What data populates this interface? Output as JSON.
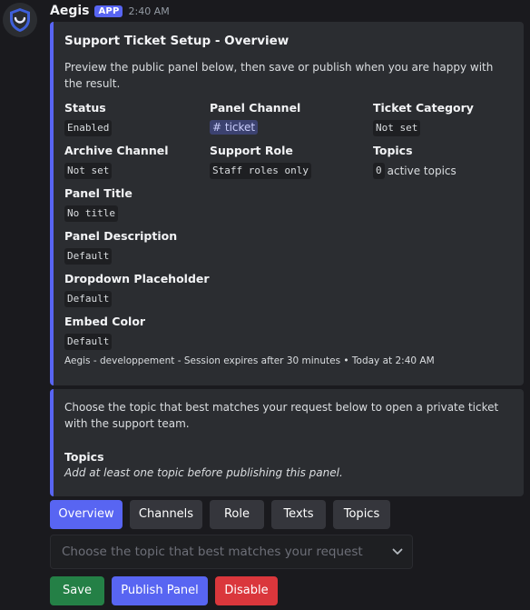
{
  "message": {
    "author": "Aegis",
    "app_tag": "APP",
    "time": "2:40 AM"
  },
  "overview": {
    "title": "Support Ticket Setup - Overview",
    "description": "Preview the public panel below, then save or publish when you are happy with the result.",
    "fields": {
      "status": {
        "name": "Status",
        "value": "Enabled"
      },
      "panel_channel": {
        "name": "Panel Channel",
        "value": "ticket"
      },
      "ticket_category": {
        "name": "Ticket Category",
        "value": "Not set"
      },
      "archive_channel": {
        "name": "Archive Channel",
        "value": "Not set"
      },
      "support_role": {
        "name": "Support Role",
        "value": "Staff roles only"
      },
      "topics": {
        "name": "Topics",
        "count": "0",
        "suffix": "active topics"
      },
      "panel_title": {
        "name": "Panel Title",
        "value": "No title"
      },
      "panel_description": {
        "name": "Panel Description",
        "value": "Default"
      },
      "dropdown_placeholder": {
        "name": "Dropdown Placeholder",
        "value": "Default"
      },
      "embed_color": {
        "name": "Embed Color",
        "value": "Default"
      }
    },
    "footer": "Aegis - developpement - Session expires after 30 minutes • Today at 2:40 AM"
  },
  "preview": {
    "description": "Choose the topic that best matches your request below to open a private ticket with the support team.",
    "field_name": "Topics",
    "field_value": "Add at least one topic before publishing this panel."
  },
  "tabs": {
    "overview": "Overview",
    "channels": "Channels",
    "role": "Role",
    "texts": "Texts",
    "topics": "Topics"
  },
  "select": {
    "placeholder": "Choose the topic that best matches your request"
  },
  "actions": {
    "save": "Save",
    "publish": "Publish Panel",
    "disable": "Disable"
  },
  "colors": {
    "accent": "#5865f2",
    "success": "#248046",
    "danger": "#da373c"
  }
}
